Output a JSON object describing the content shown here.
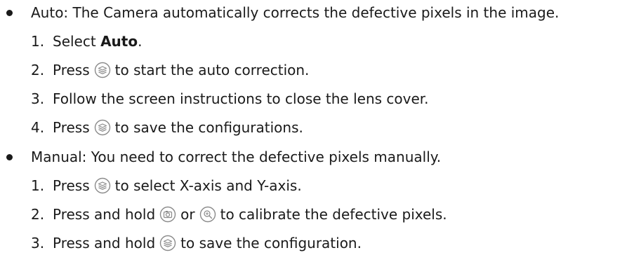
{
  "auto": {
    "bullet_text": "Auto: The Camera automatically corrects the defective pixels in the image.",
    "steps": [
      {
        "num": "1.",
        "pre": "Select ",
        "bold": "Auto",
        "post": "."
      },
      {
        "num": "2.",
        "pre": "Press",
        "post": "to start the auto correction.",
        "icon": "layers-button-icon"
      },
      {
        "num": "3.",
        "text": "Follow the screen instructions to close the lens cover."
      },
      {
        "num": "4.",
        "pre": "Press",
        "post": "to save the configurations.",
        "icon": "layers-button-icon"
      }
    ]
  },
  "manual": {
    "bullet_text": "Manual: You need to correct the defective pixels manually.",
    "steps": [
      {
        "num": "1.",
        "pre": "Press",
        "post": "to select X-axis and Y-axis.",
        "icon": "layers-button-icon"
      },
      {
        "num": "2.",
        "pre": "Press and hold",
        "mid": "or",
        "post": "to calibrate the defective pixels.",
        "icons": [
          "camera-button-icon",
          "zoom-button-icon"
        ]
      },
      {
        "num": "3.",
        "pre": "Press and hold",
        "post": "to save the configuration.",
        "icon": "layers-button-icon"
      }
    ]
  },
  "icon_color": "#8a8a8a"
}
